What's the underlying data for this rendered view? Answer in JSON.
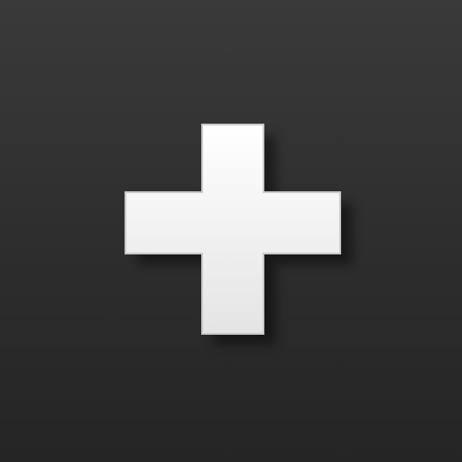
{
  "app_icon": {
    "icon": "plus-icon",
    "colors": {
      "background_top": "#3a3a3a",
      "background_bottom": "#252525",
      "plus_fill_top": "#ffffff",
      "plus_fill_bottom": "#e4e4e4",
      "plus_outline": "#c9c9c9"
    }
  }
}
